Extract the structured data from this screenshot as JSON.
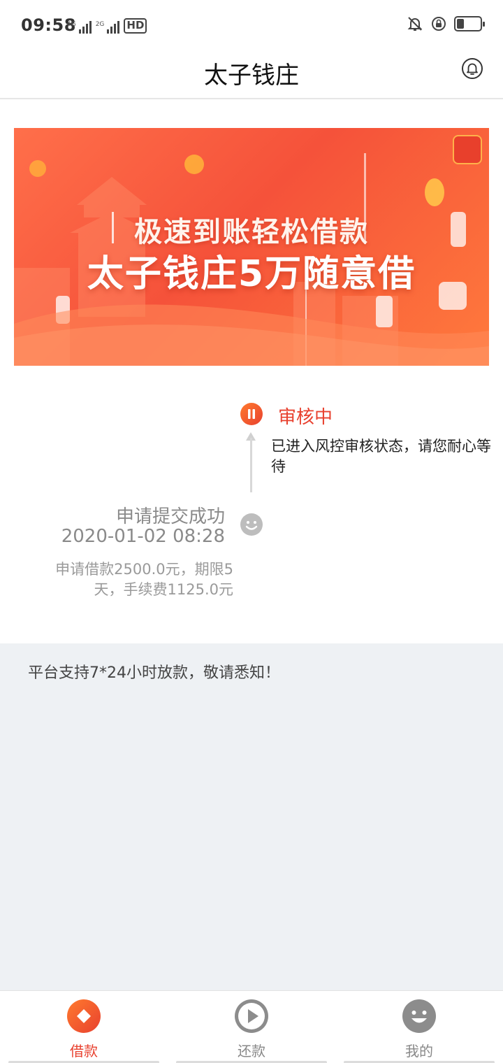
{
  "status_bar": {
    "time": "09:58",
    "sim1_tag": "4G",
    "sim2_tag": "2G",
    "hd_label": "HD",
    "battery_level": 0.3
  },
  "header": {
    "title": "太子钱庄",
    "bell_icon": "bell-icon"
  },
  "banner": {
    "line1": "极速到账轻松借款",
    "line2": "太子钱庄5万随意借",
    "colors": {
      "start": "#ff6f4a",
      "mid": "#f5523a",
      "end": "#ff7a3c"
    }
  },
  "timeline": {
    "review": {
      "status": "审核中",
      "description": "已进入风控审核状态，请您耐心等待",
      "icon": "pause-icon",
      "color": "#e8412f"
    },
    "submitted": {
      "title": "申请提交成功",
      "time": "2020-01-02 08:28",
      "detail": "申请借款2500.0元，期限5天，手续费1125.0元",
      "icon": "smiley-icon"
    }
  },
  "notice": {
    "text": "平台支持7*24小时放款，敬请悉知！"
  },
  "bottom_nav": {
    "items": [
      {
        "label": "借款",
        "icon": "diamond-icon",
        "active": true
      },
      {
        "label": "还款",
        "icon": "play-icon",
        "active": false
      },
      {
        "label": "我的",
        "icon": "smiley-icon",
        "active": false
      }
    ],
    "active_color": "#e8412f"
  }
}
